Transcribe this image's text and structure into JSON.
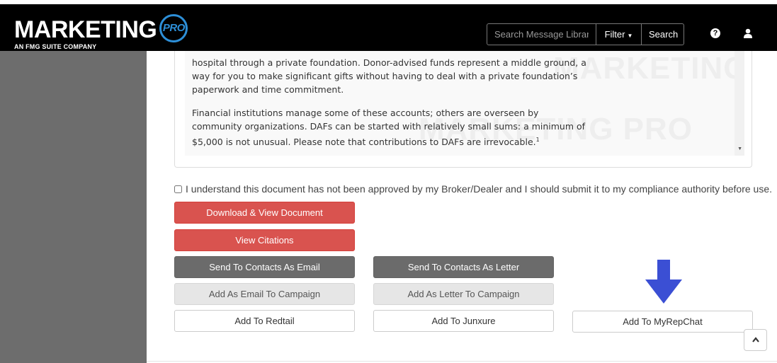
{
  "header": {
    "logo_text": "MARKETING",
    "logo_badge": "PRO",
    "logo_sub": "AN FMG SUITE COMPANY",
    "search_placeholder": "Search Message Library",
    "filter_label": "Filter",
    "search_label": "Search",
    "help_icon": "question-circle-icon",
    "user_icon": "user-icon"
  },
  "document": {
    "paragraph_1": "hospital through a private foundation. Donor-advised funds represent a middle ground, a way for you to make significant gifts without having to deal with a private foundation’s paperwork and time commitment.",
    "paragraph_2": "Financial institutions manage some of these accounts; others are overseen by community organizations. DAFs can be started with relatively small sums: a minimum of $5,000 is not unusual. Please note that contributions to DAFs are irrevocable.",
    "footnote_mark": "1",
    "watermark": "MARKETING PRO"
  },
  "compliance": {
    "label": "I understand this document has not been approved by my Broker/Dealer and I should submit it to my compliance authority before use.",
    "checked": false
  },
  "actions": {
    "download": "Download & View Document",
    "citations": "View Citations",
    "send_email": "Send To Contacts As Email",
    "send_letter": "Send To Contacts As Letter",
    "add_email_campaign": "Add As Email To Campaign",
    "add_letter_campaign": "Add As Letter To Campaign",
    "add_redtail": "Add To Redtail",
    "add_junxure": "Add To Junxure",
    "add_myrepchat": "Add To MyRepChat"
  },
  "colors": {
    "header_bg": "#000000",
    "accent_blue": "#2d8fd8",
    "sidebar_bg": "#6d6d6d",
    "red_button": "#d9534f",
    "dark_button": "#6b6b6b",
    "annotation_arrow": "#3b4fd4"
  }
}
